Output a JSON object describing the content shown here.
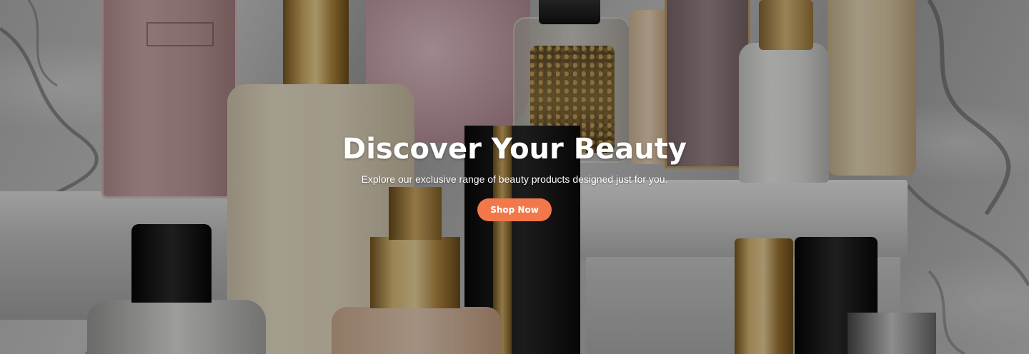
{
  "hero": {
    "title": "Discover Your Beauty",
    "subtitle": "Explore our exclusive range of beauty products designed just for you.",
    "cta_label": "Shop Now"
  },
  "colors": {
    "cta_background": "#f2784b",
    "text": "#ffffff",
    "overlay": "rgba(0,0,0,0.32)"
  }
}
